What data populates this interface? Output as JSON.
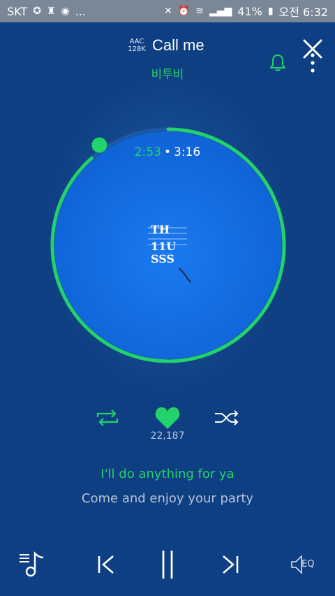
{
  "status_bar": {
    "carrier": "SKT",
    "battery_percent": "41%",
    "time": "오전 6:32",
    "ellipsis": "..."
  },
  "header": {
    "quality_line1": "AAC",
    "quality_line2": "128K",
    "song_title": "Call me",
    "artist": "비투비"
  },
  "player": {
    "elapsed": "2:53",
    "separator": "•",
    "duration": "3:16",
    "progress_fraction": 0.885,
    "album_art_text": [
      "TH",
      "11U",
      "SSS"
    ]
  },
  "actions": {
    "like_count": "22,187"
  },
  "lyrics": {
    "current": "I'll do anything for ya",
    "next": "Come and enjoy your party"
  },
  "controls": {
    "eq_label": "EQ"
  },
  "colors": {
    "background": "#0e3f82",
    "accent": "#22d36b",
    "disc": "#1672e6"
  }
}
